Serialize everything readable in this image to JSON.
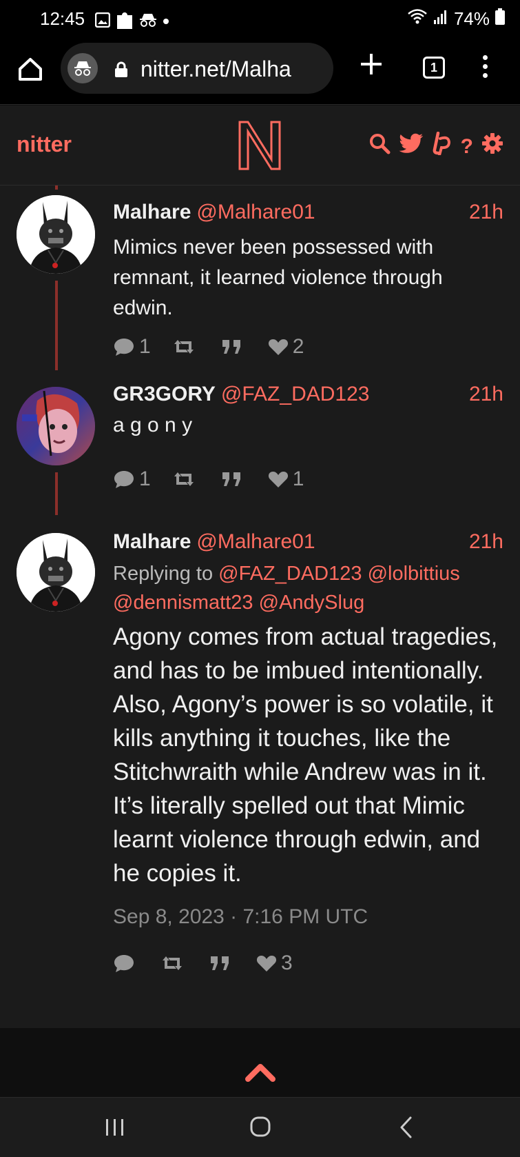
{
  "status_bar": {
    "time": "12:45",
    "battery": "74%",
    "left_icons": [
      "gallery-icon",
      "puzzle-icon",
      "incognito-icon",
      "dot-icon"
    ],
    "right_icons": [
      "wifi-icon",
      "signal-icon",
      "battery-icon"
    ]
  },
  "browser": {
    "url": "nitter.net/Malha",
    "tab_count": "1",
    "buttons": [
      "home-icon",
      "incognito-icon",
      "lock-icon",
      "plus-icon",
      "tabs-icon",
      "menu-icon"
    ]
  },
  "nitter_nav": {
    "brand": "nitter",
    "logo_letter": "N",
    "icons": [
      "search-icon",
      "twitter-icon",
      "liberapay-icon",
      "help-icon",
      "settings-icon"
    ],
    "help_label": "?",
    "accent_color": "#ff6c60"
  },
  "tweets": [
    {
      "fullname": "Malhare",
      "username": "@Malhare01",
      "date": "21h",
      "text": "Mimics never been possessed with remnant, it learned violence through edwin.",
      "stats": {
        "replies": "1",
        "retweets": "",
        "quotes": "",
        "likes": "2"
      }
    },
    {
      "fullname": "GR3GORY",
      "username": "@FAZ_DAD123",
      "date": "21h",
      "text": "a g o n y",
      "stats": {
        "replies": "1",
        "retweets": "",
        "quotes": "",
        "likes": "1"
      }
    },
    {
      "fullname": "Malhare",
      "username": "@Malhare01",
      "date": "21h",
      "replying_prefix": "Replying to",
      "replying_to": [
        "@FAZ_DAD123",
        "@lolbittius",
        "@dennismatt23",
        "@AndySlug"
      ],
      "text": "Agony comes from actual tragedies, and has to be imbued intentionally. Also, Agony’s power is so volatile, it kills anything it touches, like the Stitchwraith while Andrew was in it. It’s literally spelled out that Mimic learnt violence through edwin, and he copies it.",
      "published": "Sep 8, 2023 · 7:16 PM UTC",
      "stats": {
        "replies": "",
        "retweets": "",
        "quotes": "",
        "likes": "3"
      }
    }
  ],
  "colors": {
    "background": "#1b1b1b",
    "accent": "#ff6c60",
    "thread_line": "#8c2f2a",
    "muted": "#999999"
  }
}
